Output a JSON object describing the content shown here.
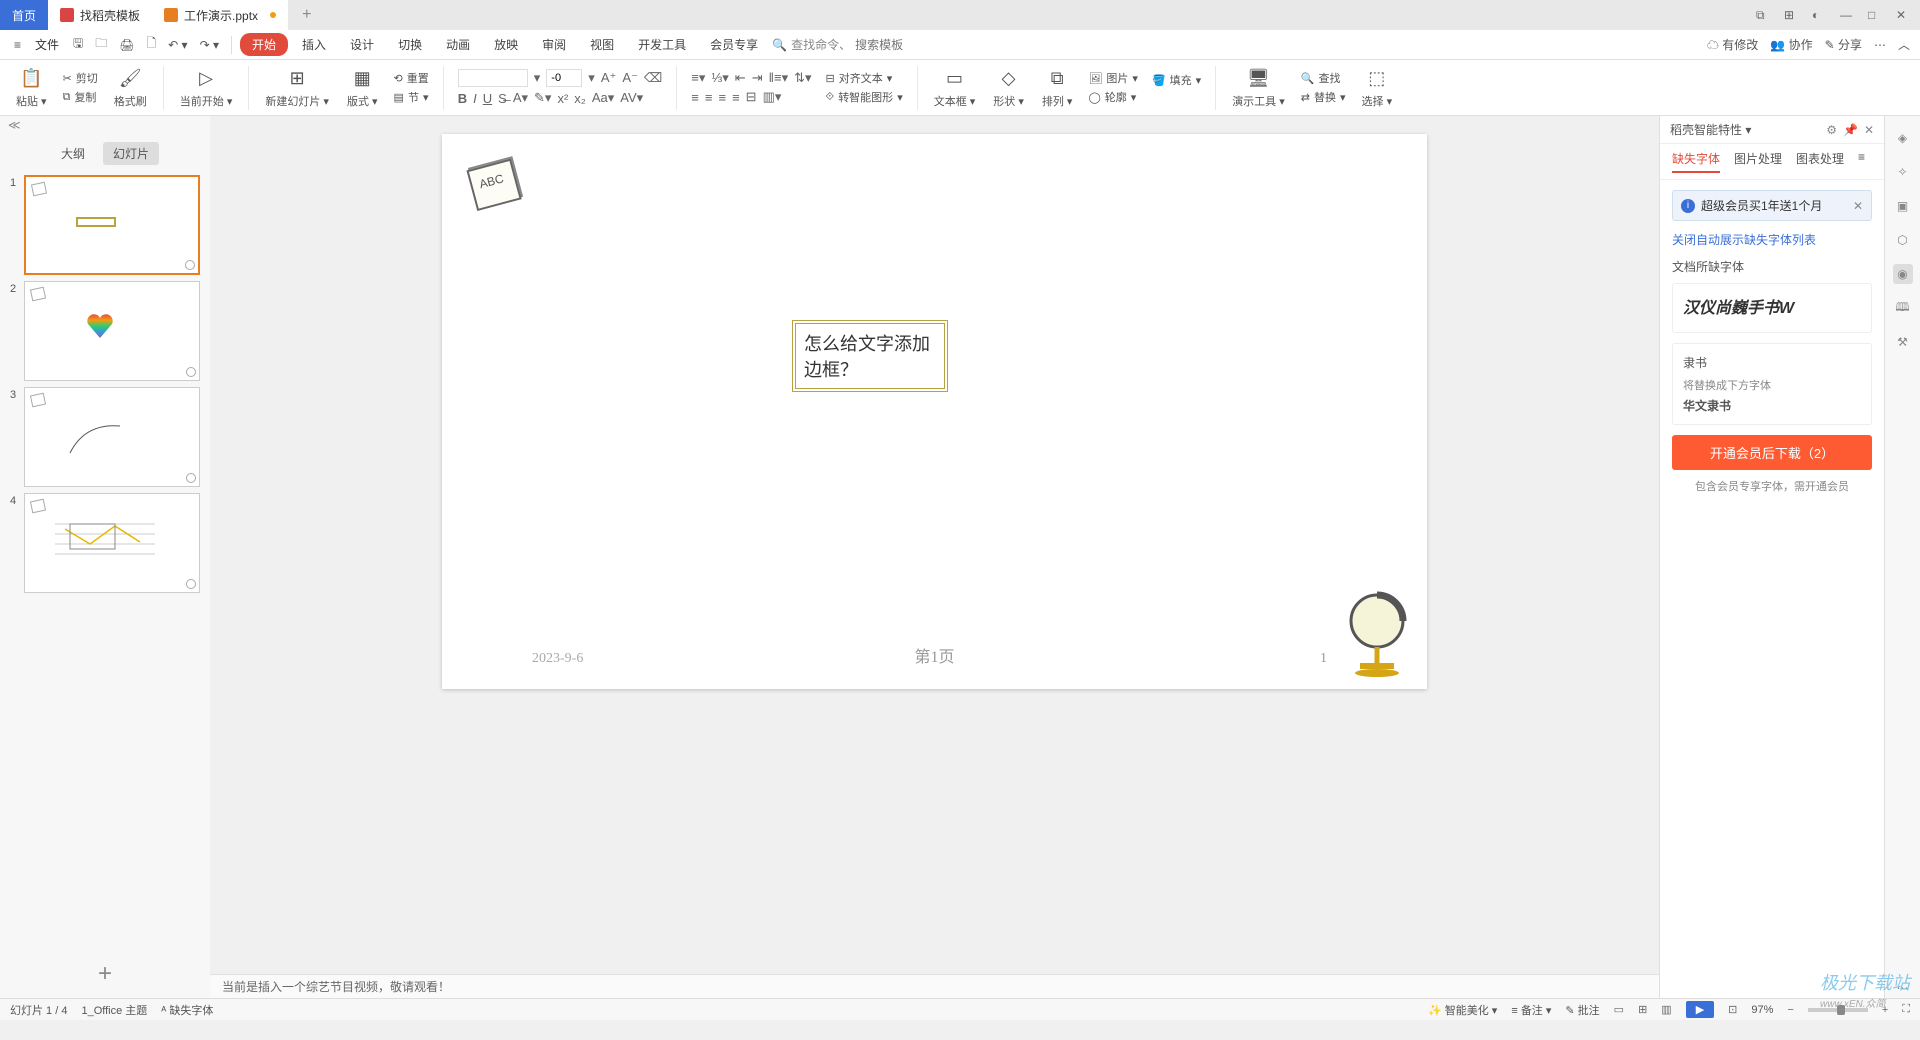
{
  "titlebar": {
    "home": "首页",
    "tab1": "找稻壳模板",
    "tab2": "工作演示.pptx"
  },
  "menubar": {
    "file": "文件",
    "tabs": [
      "开始",
      "插入",
      "设计",
      "切换",
      "动画",
      "放映",
      "审阅",
      "视图",
      "开发工具",
      "会员专享"
    ],
    "search_label": "查找命令、",
    "search_placeholder": "搜索模板",
    "right": {
      "modified": "有修改",
      "collab": "协作",
      "share": "分享"
    }
  },
  "ribbon": {
    "paste": "粘贴",
    "cut": "剪切",
    "copy": "复制",
    "format_painter": "格式刷",
    "from_current": "当前开始",
    "new_slide": "新建幻灯片",
    "layout": "版式",
    "section": "节",
    "reset": "重置",
    "align_text": "对齐文本",
    "convert_smart": "转智能图形",
    "textbox": "文本框",
    "shape": "形状",
    "arrange": "排列",
    "picture": "图片",
    "fill": "填充",
    "outline": "轮廓",
    "present_tools": "演示工具",
    "find": "查找",
    "replace": "替换",
    "select": "选择",
    "font_size": "-0"
  },
  "left": {
    "outline": "大纲",
    "slides": "幻灯片"
  },
  "slide": {
    "text": "怎么给文字添加边框？",
    "date": "2023-9-6",
    "page": "第1页",
    "num": "1",
    "abc": "ABC"
  },
  "status_msg": "当前是插入一个综艺节目视频，敬请观看！",
  "rightpanel": {
    "title": "稻壳智能特性",
    "tabs": [
      "缺失字体",
      "图片处理",
      "图表处理"
    ],
    "banner": "超级会员买1年送1个月",
    "link": "关闭自动展示缺失字体列表",
    "section": "文档所缺字体",
    "font1": "汉仪尚巍手书W",
    "font2_name": "隶书",
    "font2_replace_label": "将替换成下方字体",
    "font2_replace": "华文隶书",
    "button": "开通会员后下载（2）",
    "note": "包含会员专享字体，需开通会员"
  },
  "statusbar": {
    "slide_pos": "幻灯片 1 / 4",
    "theme": "1_Office 主题",
    "missing_font": "缺失字体",
    "smart_beauty": "智能美化",
    "notes": "备注",
    "comments": "批注",
    "zoom": "97%"
  },
  "watermark": {
    "main": "极光下载站",
    "sub": "www.xEN.众简"
  }
}
